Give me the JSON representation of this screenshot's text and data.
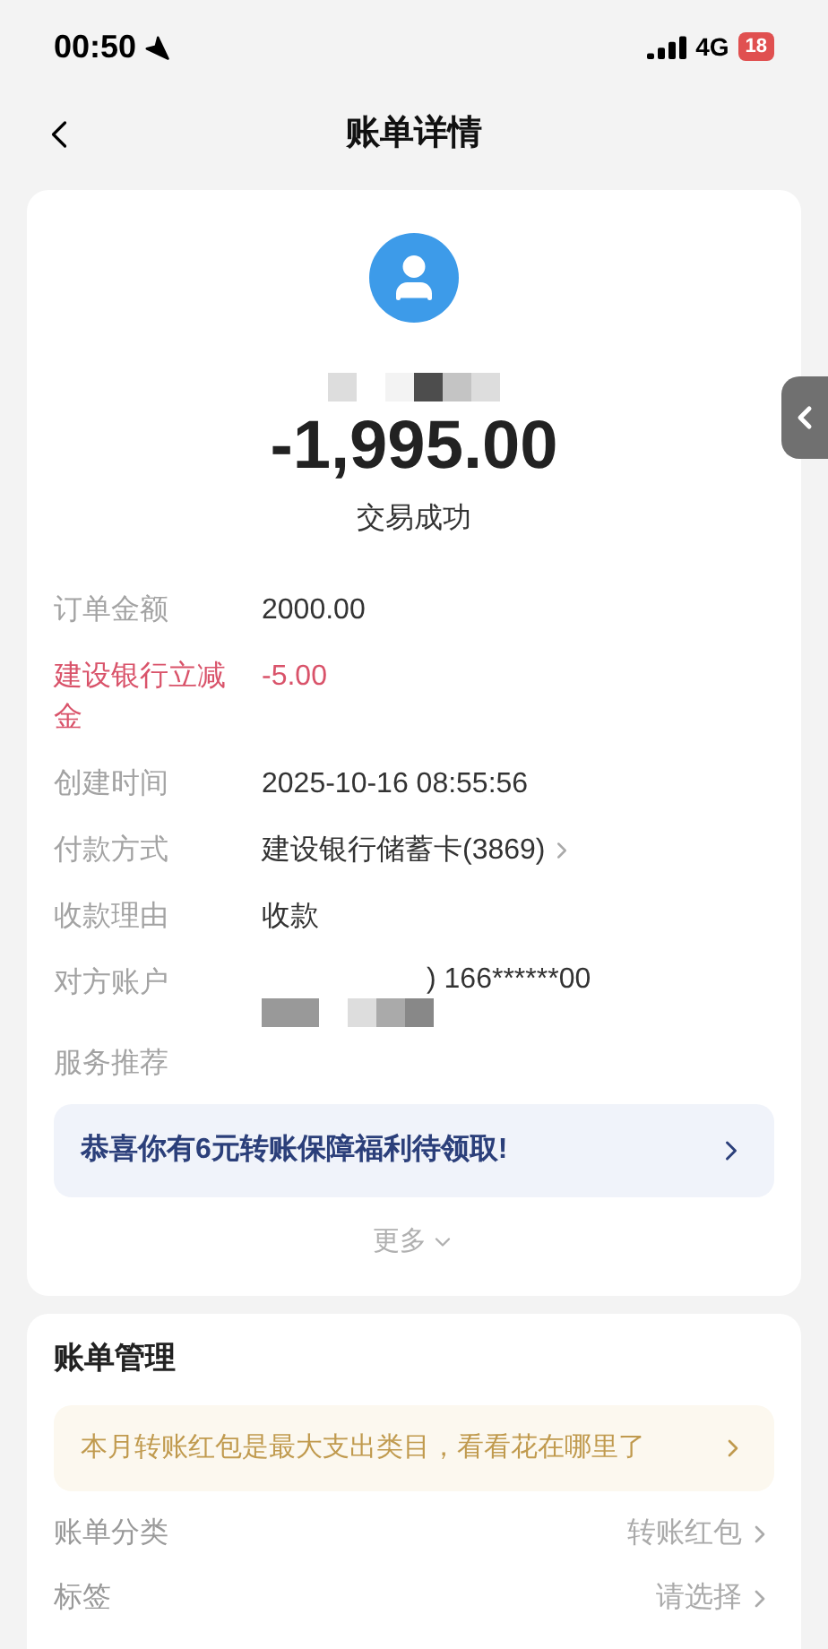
{
  "status_bar": {
    "time": "00:50",
    "network": "4G",
    "battery": "18"
  },
  "nav": {
    "title": "账单详情"
  },
  "summary": {
    "amount": "-1,995.00",
    "status": "交易成功"
  },
  "details": [
    {
      "label": "订单金额",
      "value": "2000.00",
      "kind": "plain"
    },
    {
      "label": "建设银行立减金",
      "value": "-5.00",
      "kind": "discount"
    },
    {
      "label": "创建时间",
      "value": "2025-10-16 08:55:56",
      "kind": "plain"
    },
    {
      "label": "付款方式",
      "value": "建设银行储蓄卡(3869)",
      "kind": "link"
    },
    {
      "label": "收款理由",
      "value": "收款",
      "kind": "plain"
    },
    {
      "label": "对方账户",
      "value": ") 166******00",
      "kind": "masked"
    },
    {
      "label": "服务推荐",
      "kind": "empty"
    }
  ],
  "promo": {
    "text": "恭喜你有6元转账保障福利待领取!"
  },
  "more": {
    "label": "更多"
  },
  "management": {
    "title": "账单管理",
    "tip": "本月转账红包是最大支出类目，看看花在哪里了",
    "rows": [
      {
        "label": "账单分类",
        "value": "转账红包"
      },
      {
        "label": "标签",
        "value": "请选择"
      }
    ]
  }
}
